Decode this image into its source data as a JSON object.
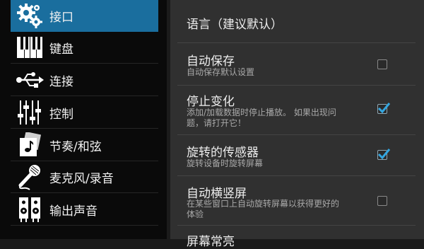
{
  "sidebar": {
    "items": [
      {
        "label": "接口",
        "icon": "gears-icon",
        "active": true
      },
      {
        "label": "键盘",
        "icon": "piano-keys-icon",
        "active": false
      },
      {
        "label": "连接",
        "icon": "usb-icon",
        "active": false
      },
      {
        "label": "控制",
        "icon": "sliders-icon",
        "active": false
      },
      {
        "label": "节奏/和弦",
        "icon": "music-note-icon",
        "active": false
      },
      {
        "label": "麦克风/录音",
        "icon": "microphone-icon",
        "active": false
      },
      {
        "label": "输出声音",
        "icon": "speakers-icon",
        "active": false
      }
    ]
  },
  "settings": {
    "language_title": "语言（建议默认）",
    "auto_save": {
      "title": "自动保存",
      "summary": "自动保存默认设置",
      "checked": false
    },
    "stop_change": {
      "title": "停止变化",
      "summary_line1": "添加/加载数据时停止播放。 如果出现问",
      "summary_line2": "题，请打开它！",
      "checked": true
    },
    "rotation_sensor": {
      "title": "旋转的传感器",
      "summary": "旋转设备时旋转屏幕",
      "checked": true
    },
    "auto_orientation": {
      "title": "自动横竖屏",
      "summary_line1": "在某些窗口上自动旋转屏幕以获得更好的",
      "summary_line2": "体验",
      "checked": false
    },
    "screen_partial_title": "屏幕常亮"
  },
  "colors": {
    "accent": "#1a6e9e",
    "sidebar_bg": "#0a0a0a",
    "content_bg": "#303030",
    "checkmark": "#33a6e0"
  }
}
